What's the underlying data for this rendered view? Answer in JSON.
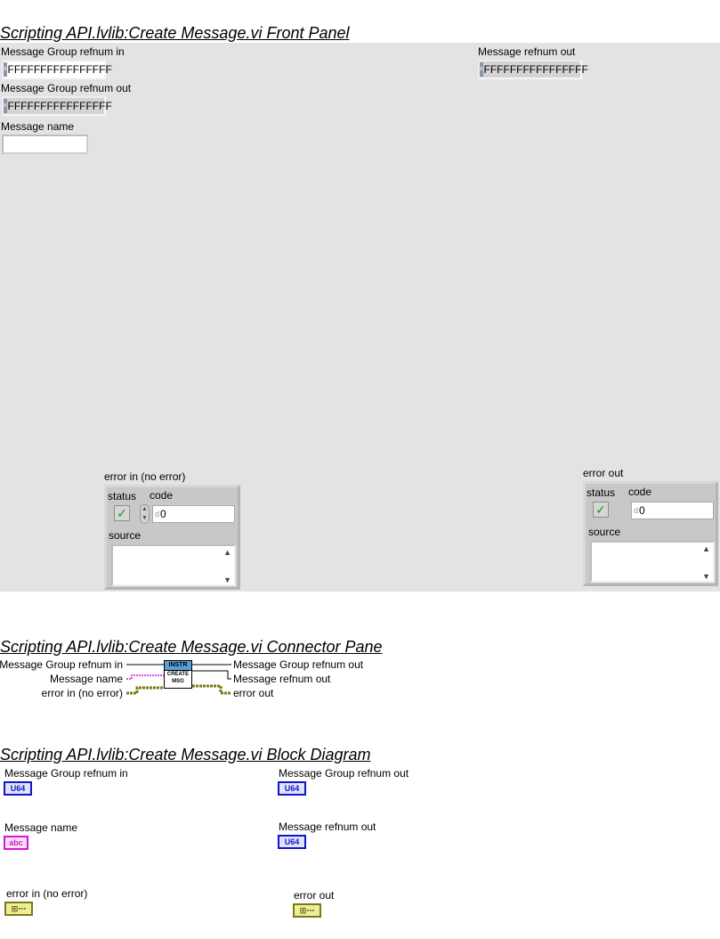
{
  "front_panel": {
    "heading": "Scripting API.lvlib:Create Message.vi Front Panel",
    "msg_group_in": {
      "label": "Message Group refnum in",
      "value": "FFFFFFFFFFFFFFFF"
    },
    "msg_group_out": {
      "label": "Message Group refnum out",
      "value": "FFFFFFFFFFFFFFFF"
    },
    "msg_name": {
      "label": "Message name",
      "value": ""
    },
    "msg_refnum_out": {
      "label": "Message refnum out",
      "value": "FFFFFFFFFFFFFFFF"
    },
    "refnum_tag": "x",
    "error_in": {
      "label": "error in (no error)",
      "status_label": "status",
      "code_label": "code",
      "code_value": "0",
      "code_radix": "d",
      "source_label": "source"
    },
    "error_out": {
      "label": "error out",
      "status_label": "status",
      "code_label": "code",
      "code_value": "0",
      "code_radix": "d",
      "source_label": "source"
    }
  },
  "connector_pane": {
    "heading": "Scripting API.lvlib:Create Message.vi Connector Pane",
    "left_terminals": [
      "Message Group refnum in",
      "Message name",
      "error in (no error)"
    ],
    "right_terminals": [
      "Message Group refnum out",
      "Message refnum out",
      "error out"
    ],
    "icon_top": "INSTR",
    "icon_line1": "CREATE",
    "icon_line2": "MSG"
  },
  "block_diagram": {
    "heading": "Scripting API.lvlib:Create Message.vi Block Diagram",
    "terminals": [
      {
        "label": "Message Group refnum in",
        "type": "U64"
      },
      {
        "label": "Message Group refnum out",
        "type": "U64"
      },
      {
        "label": "Message name",
        "type": "abc"
      },
      {
        "label": "Message refnum out",
        "type": "U64"
      },
      {
        "label": "error in (no error)",
        "type": "err"
      },
      {
        "label": "error out",
        "type": "err"
      }
    ],
    "err_glyph": "⊞⋯"
  },
  "colors": {
    "panel_bg": "#e3e3e3",
    "u64_wire": "#1414c8",
    "string_wire": "#d614d6",
    "error_wire": "#7a7a14"
  }
}
